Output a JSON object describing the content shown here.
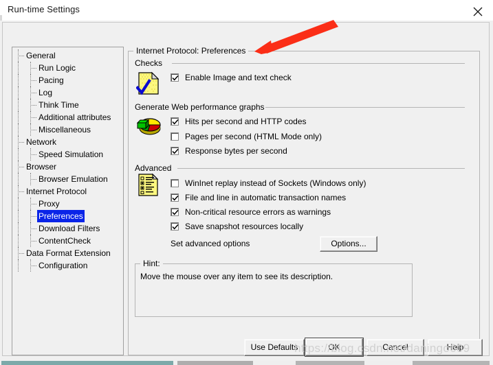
{
  "window": {
    "title": "Run-time Settings",
    "close_icon": "close-icon"
  },
  "tree": {
    "nodes": [
      {
        "label": "General",
        "level": 0,
        "selected": false
      },
      {
        "label": "Run Logic",
        "level": 1,
        "selected": false
      },
      {
        "label": "Pacing",
        "level": 1,
        "selected": false
      },
      {
        "label": "Log",
        "level": 1,
        "selected": false
      },
      {
        "label": "Think Time",
        "level": 1,
        "selected": false
      },
      {
        "label": "Additional attributes",
        "level": 1,
        "selected": false
      },
      {
        "label": "Miscellaneous",
        "level": 1,
        "selected": false
      },
      {
        "label": "Network",
        "level": 0,
        "selected": false
      },
      {
        "label": "Speed Simulation",
        "level": 1,
        "selected": false
      },
      {
        "label": "Browser",
        "level": 0,
        "selected": false
      },
      {
        "label": "Browser Emulation",
        "level": 1,
        "selected": false
      },
      {
        "label": "Internet Protocol",
        "level": 0,
        "selected": false
      },
      {
        "label": "Proxy",
        "level": 1,
        "selected": false
      },
      {
        "label": "Preferences",
        "level": 1,
        "selected": true
      },
      {
        "label": "Download Filters",
        "level": 1,
        "selected": false
      },
      {
        "label": "ContentCheck",
        "level": 1,
        "selected": false
      },
      {
        "label": "Data Format Extension",
        "level": 0,
        "selected": false
      },
      {
        "label": "Configuration",
        "level": 1,
        "selected": false
      }
    ]
  },
  "panel": {
    "title": "Internet Protocol: Preferences",
    "sections": {
      "checks": {
        "caption": "Checks",
        "icon": "page-check-icon",
        "options": [
          {
            "label": "Enable Image and text check",
            "checked": true
          }
        ]
      },
      "graphs": {
        "caption": "Generate Web performance graphs",
        "icon": "pie-chart-icon",
        "options": [
          {
            "label": "Hits per second and HTTP codes",
            "checked": true
          },
          {
            "label": "Pages per second (HTML Mode only)",
            "checked": false
          },
          {
            "label": "Response bytes per second",
            "checked": true
          }
        ]
      },
      "advanced": {
        "caption": "Advanced",
        "icon": "checklist-form-icon",
        "options": [
          {
            "label": "WinInet replay instead of Sockets (Windows only)",
            "checked": false
          },
          {
            "label": "File and line in automatic transaction names",
            "checked": true
          },
          {
            "label": "Non-critical resource errors as warnings",
            "checked": true
          },
          {
            "label": "Save snapshot resources locally",
            "checked": true
          }
        ],
        "advanced_options_label": "Set advanced options",
        "options_button": "Options..."
      },
      "hint": {
        "caption": "Hint:",
        "text": "Move the mouse over any item to see its description."
      }
    }
  },
  "footer": {
    "buttons": [
      {
        "label": "Use Defaults",
        "default": false
      },
      {
        "label": "OK",
        "default": true
      },
      {
        "label": "Cancel",
        "default": false
      },
      {
        "label": "Help",
        "default": false
      }
    ]
  },
  "annotation": {
    "arrow_color": "#fb2e17",
    "arrow_points_to": "Enable Image and text check"
  },
  "watermark": {
    "text": "https://blog.csdn.net/daningo609"
  },
  "colors": {
    "dialog_background": "#f0f0f0",
    "selection_blue": "#0a24e8",
    "accent_red": "#fb2e17",
    "icon_yellow": "#f7f06a",
    "border_gray": "#b4b4b4"
  }
}
